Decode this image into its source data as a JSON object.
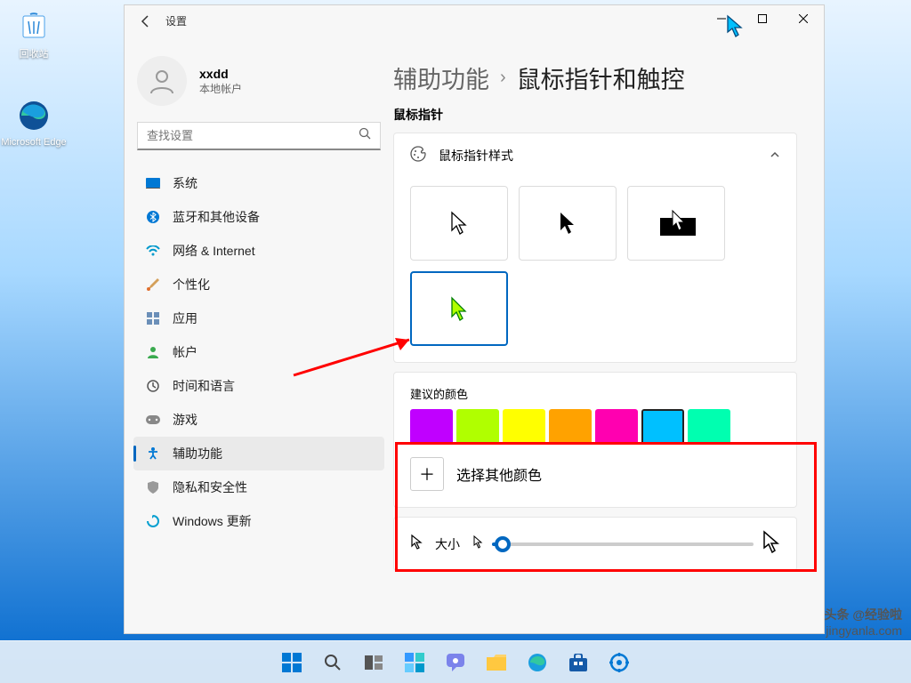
{
  "desktop": {
    "recycle": "回收站",
    "edge": "Microsoft Edge"
  },
  "window": {
    "title": "设置",
    "account": {
      "name": "xxdd",
      "type": "本地帐户"
    },
    "search_placeholder": "查找设置",
    "nav": [
      {
        "id": "system",
        "label": "系统"
      },
      {
        "id": "bluetooth",
        "label": "蓝牙和其他设备"
      },
      {
        "id": "network",
        "label": "网络 & Internet"
      },
      {
        "id": "personalize",
        "label": "个性化"
      },
      {
        "id": "apps",
        "label": "应用"
      },
      {
        "id": "accounts",
        "label": "帐户"
      },
      {
        "id": "time",
        "label": "时间和语言"
      },
      {
        "id": "gaming",
        "label": "游戏"
      },
      {
        "id": "accessibility",
        "label": "辅助功能"
      },
      {
        "id": "privacy",
        "label": "隐私和安全性"
      },
      {
        "id": "update",
        "label": "Windows 更新"
      }
    ],
    "breadcrumb": {
      "parent": "辅助功能",
      "current": "鼠标指针和触控"
    },
    "section_pointer": "鼠标指针",
    "style_card_title": "鼠标指针样式",
    "colors_label": "建议的颜色",
    "colors": [
      "#c000ff",
      "#b0ff00",
      "#ffff00",
      "#ffa200",
      "#ff00b0",
      "#00c0ff",
      "#00ffb0"
    ],
    "selected_color_index": 5,
    "more_color": "选择其他颜色",
    "size_label": "大小"
  },
  "watermark": {
    "line1": "头条 @经验啦",
    "line2": "jingyanla.com"
  }
}
